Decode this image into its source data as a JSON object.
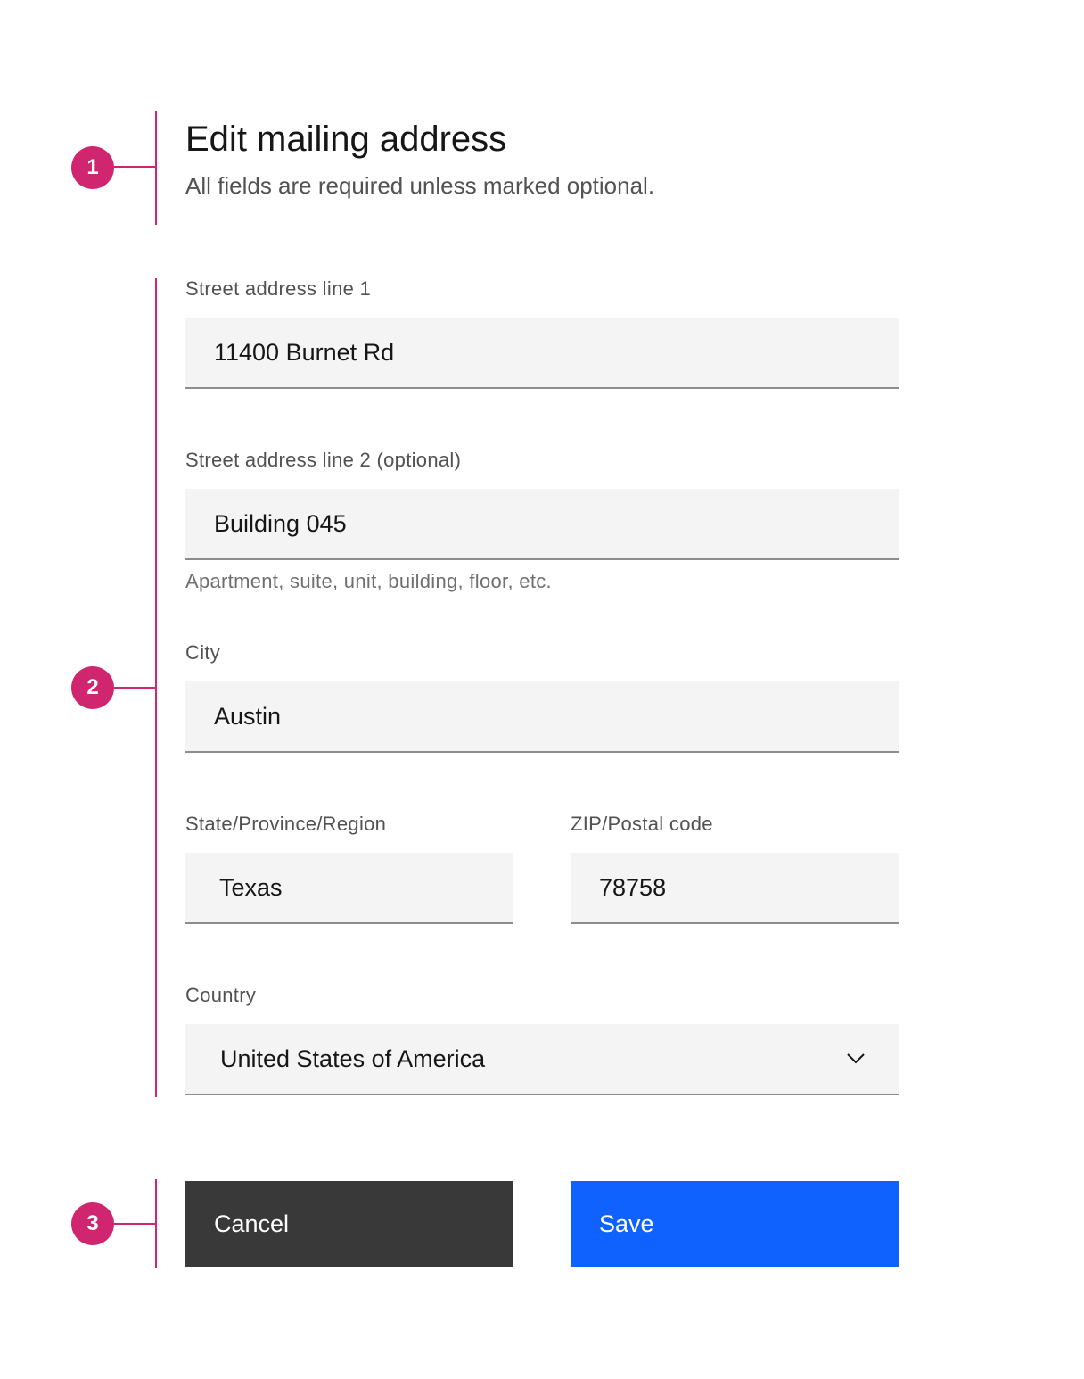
{
  "annotations": [
    "1",
    "2",
    "3"
  ],
  "header": {
    "title": "Edit mailing address",
    "subtitle": "All fields are required unless marked optional."
  },
  "fields": {
    "street1": {
      "label": "Street address line 1",
      "value": "11400 Burnet Rd"
    },
    "street2": {
      "label": "Street address line 2 (optional)",
      "value": "Building 045",
      "helper": "Apartment, suite, unit, building, floor, etc."
    },
    "city": {
      "label": "City",
      "value": "Austin"
    },
    "state": {
      "label": "State/Province/Region",
      "value": "Texas"
    },
    "zip": {
      "label": "ZIP/Postal code",
      "value": "78758"
    },
    "country": {
      "label": "Country",
      "value": "United States of America",
      "icon": "chevron-down-icon"
    }
  },
  "actions": {
    "cancel_label": "Cancel",
    "save_label": "Save"
  },
  "colors": {
    "annotation": "#d02670",
    "field_background": "#f4f4f4",
    "field_border": "#8d8d8d",
    "cancel_button": "#393939",
    "save_button": "#0f62fe"
  }
}
